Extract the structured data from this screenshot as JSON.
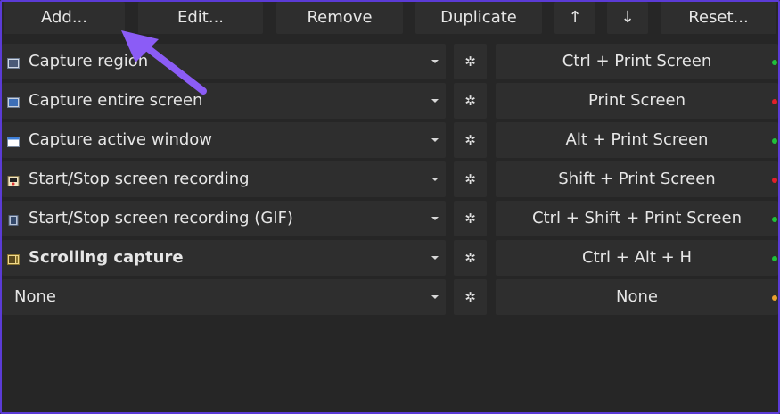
{
  "toolbar": {
    "add_label": "Add...",
    "edit_label": "Edit...",
    "remove_label": "Remove",
    "duplicate_label": "Duplicate",
    "move_up_label": "↑",
    "move_down_label": "↓",
    "reset_label": "Reset..."
  },
  "rows": [
    {
      "task": "Capture region",
      "icon": "capture-region-icon",
      "hotkey": "Ctrl + Print Screen",
      "status_color": "#1fbf3a",
      "bold": false
    },
    {
      "task": "Capture entire screen",
      "icon": "capture-screen-icon",
      "hotkey": "Print Screen",
      "status_color": "#e0202a",
      "bold": false
    },
    {
      "task": "Capture active window",
      "icon": "capture-window-icon",
      "hotkey": "Alt + Print Screen",
      "status_color": "#1fbf3a",
      "bold": false
    },
    {
      "task": "Start/Stop screen recording",
      "icon": "screen-recording-icon",
      "hotkey": "Shift + Print Screen",
      "status_color": "#e0202a",
      "bold": false
    },
    {
      "task": "Start/Stop screen recording (GIF)",
      "icon": "gif-recording-icon",
      "hotkey": "Ctrl + Shift + Print Screen",
      "status_color": "#1fbf3a",
      "bold": false
    },
    {
      "task": "Scrolling capture",
      "icon": "scrolling-capture-icon",
      "hotkey": "Ctrl + Alt + H",
      "status_color": "#1fbf3a",
      "bold": true
    },
    {
      "task": "None",
      "icon": "",
      "hotkey": "None",
      "status_color": "#e8a030",
      "bold": false
    }
  ],
  "icons": {
    "settings": "gear-icon",
    "dropdown": "chevron-down-icon",
    "annotation": "pointer-arrow-icon"
  },
  "colors": {
    "annotation_arrow": "#8b5cf6",
    "frame_border": "#5b3bd6",
    "status_active": "#1fbf3a",
    "status_conflict": "#e0202a",
    "status_unset": "#e8a030"
  }
}
